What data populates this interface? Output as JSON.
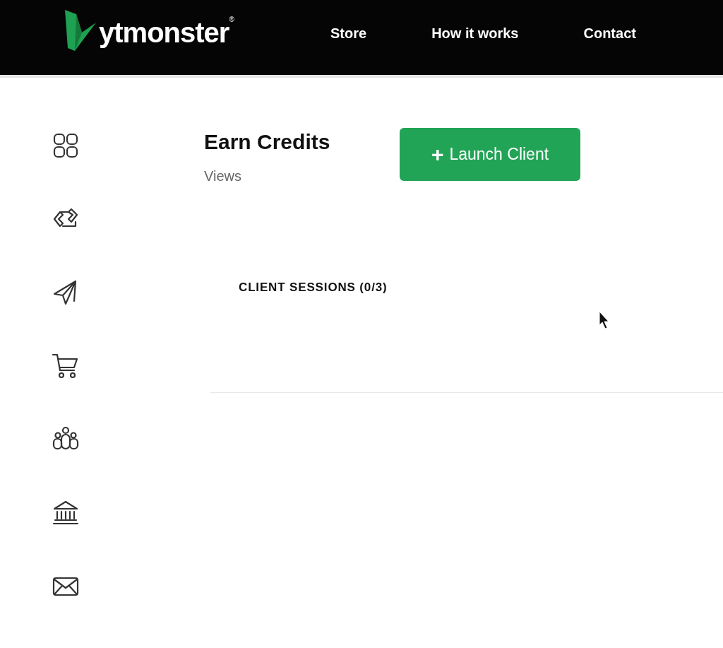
{
  "header": {
    "logo": "ytmonster",
    "logo_mark": "®",
    "nav": [
      "Store",
      "How it works",
      "Contact"
    ]
  },
  "sidebar": [
    {
      "kind": "grid"
    },
    {
      "kind": "exchange"
    },
    {
      "kind": "send"
    },
    {
      "kind": "cart"
    },
    {
      "kind": "people"
    },
    {
      "kind": "bank"
    },
    {
      "kind": "mail"
    }
  ],
  "main": {
    "title": "Earn Credits",
    "subtitle": "Views",
    "button": {
      "icon": "+",
      "label": "Launch Client"
    },
    "sessions_heading": "CLIENT SESSIONS (0/3)"
  }
}
